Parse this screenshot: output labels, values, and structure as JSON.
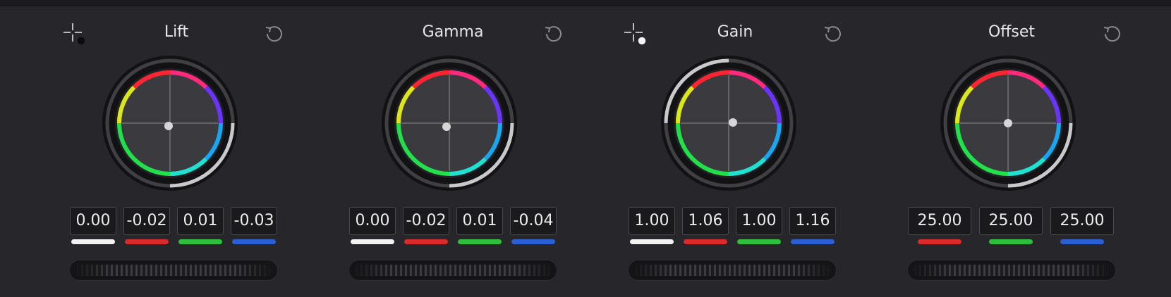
{
  "colors": {
    "background": "#26262b",
    "red_channel": "#d92b2b",
    "green_channel": "#2fbf3c",
    "blue_channel": "#2c5fd4",
    "luma_channel": "#f2f2f2"
  },
  "wheels": [
    {
      "id": "lift",
      "title": "Lift",
      "has_picker": true,
      "picker_dot": "dark",
      "values": [
        "0.00",
        "-0.02",
        "0.01",
        "-0.03"
      ],
      "channels": [
        "luma",
        "red",
        "green",
        "blue"
      ],
      "reset_icon": "reset-icon",
      "picker_icon": "crosshair-icon"
    },
    {
      "id": "gamma",
      "title": "Gamma",
      "has_picker": false,
      "values": [
        "0.00",
        "-0.02",
        "0.01",
        "-0.04"
      ],
      "channels": [
        "luma",
        "red",
        "green",
        "blue"
      ],
      "reset_icon": "reset-icon"
    },
    {
      "id": "gain",
      "title": "Gain",
      "has_picker": true,
      "picker_dot": "light",
      "values": [
        "1.00",
        "1.06",
        "1.00",
        "1.16"
      ],
      "channels": [
        "luma",
        "red",
        "green",
        "blue"
      ],
      "reset_icon": "reset-icon",
      "picker_icon": "crosshair-icon"
    },
    {
      "id": "offset",
      "title": "Offset",
      "has_picker": false,
      "values": [
        "25.00",
        "25.00",
        "25.00"
      ],
      "channels": [
        "red",
        "green",
        "blue"
      ],
      "reset_icon": "reset-icon"
    }
  ]
}
